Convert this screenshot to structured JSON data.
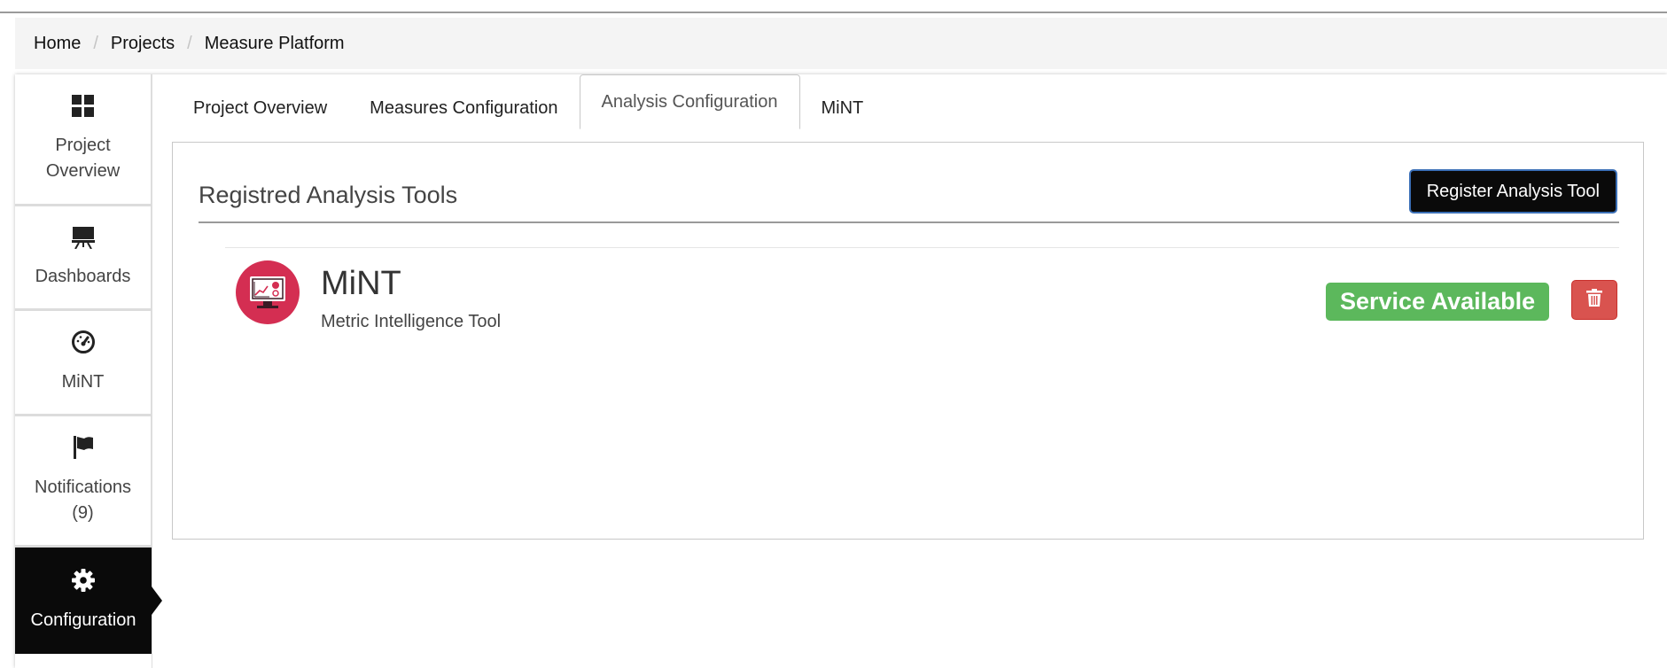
{
  "breadcrumb": {
    "items": [
      "Home",
      "Projects",
      "Measure Platform"
    ],
    "separator": "/"
  },
  "sidebar": {
    "items": [
      {
        "label_lines": [
          "Project",
          "Overview"
        ],
        "icon": "grid-icon"
      },
      {
        "label_lines": [
          "Dashboards"
        ],
        "icon": "presentation-board-icon"
      },
      {
        "label_lines": [
          "MiNT"
        ],
        "icon": "gauge-icon"
      },
      {
        "label_lines": [
          "Notifications",
          "(9)"
        ],
        "icon": "flag-icon"
      },
      {
        "label_lines": [
          "Configuration"
        ],
        "icon": "gear-icon",
        "active": true
      }
    ]
  },
  "tabs": [
    {
      "label": "Project Overview"
    },
    {
      "label": "Measures Configuration"
    },
    {
      "label": "Analysis Configuration",
      "active": true
    },
    {
      "label": "MiNT"
    }
  ],
  "main": {
    "section_title": "Registred Analysis Tools",
    "register_button": "Register Analysis Tool",
    "tools": [
      {
        "name": "MiNT",
        "description": "Metric Intelligence Tool",
        "status": "Service Available",
        "logo_icon": "monitor-analytics-icon",
        "delete_icon": "trash-icon"
      }
    ]
  },
  "colors": {
    "sidebar_active_bg": "#0a0a0a",
    "status_available": "#5cb85c",
    "delete_button": "#d9534f",
    "tool_logo_bg": "#d42e52",
    "register_button_bg": "#0a0a0a",
    "register_button_border": "#3b6fb6"
  }
}
